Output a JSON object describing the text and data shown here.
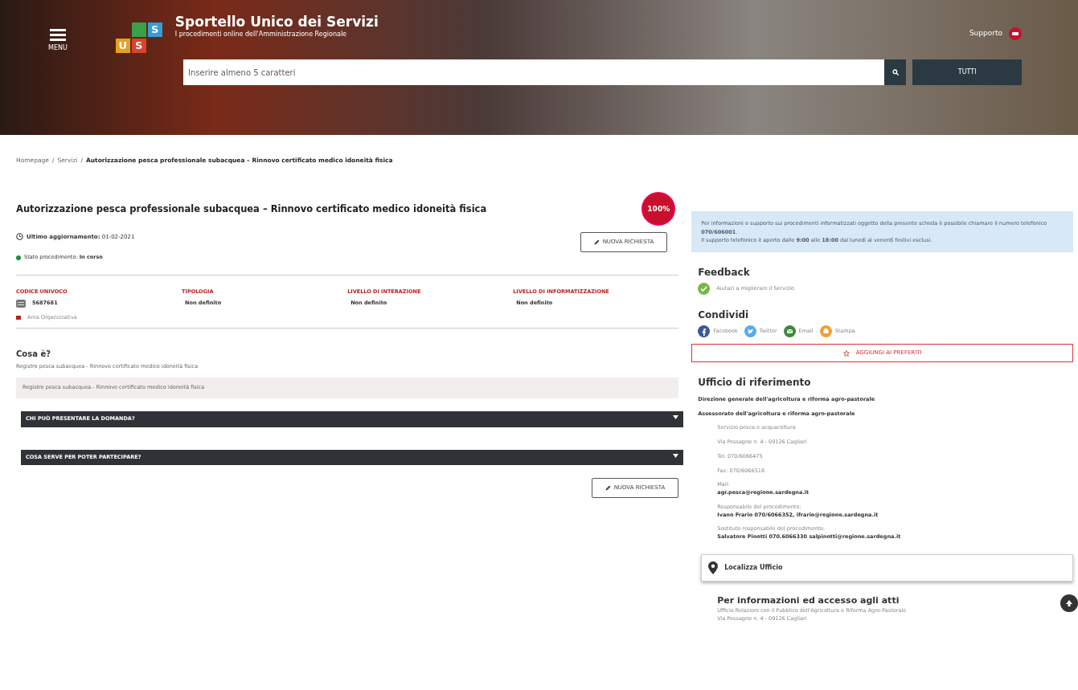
{
  "header": {
    "menu_label": "MENU",
    "logo_letters": [
      "S",
      "U",
      "S"
    ],
    "title": "Sportello Unico dei Servizi",
    "subtitle": "I procedimenti online dell'Amministrazione Regionale",
    "support": "Supporto",
    "search": {
      "placeholder": "Inserire almeno 5 caratteri"
    },
    "filter_button": "TUTTI"
  },
  "breadcrumb_separator": "/",
  "breadcrumb": [
    {
      "label": "Homepage",
      "current": false
    },
    {
      "label": "Servizi",
      "current": false
    },
    {
      "label": "Autorizzazione pesca professionale subacquea – Rinnovo certificato medico idoneità fisica",
      "current": true
    }
  ],
  "service": {
    "title": "Autorizzazione pesca professionale subacquea – Rinnovo certificato medico idoneità fisica",
    "online_badge": "100%",
    "updated_label": "Ultimo aggiornamento:",
    "updated_value": "01-02-2021",
    "status_label": "Stato procedimento:",
    "status_value": "In corso",
    "new_request": "NUOVA RICHIESTA",
    "facts": [
      {
        "label": "CODICE UNIVOCO",
        "value": "5687681",
        "kind": "code"
      },
      {
        "label": "TIPOLOGIA",
        "value": "Non definito",
        "kind": "text"
      },
      {
        "label": "LIVELLO DI INTERAZIONE",
        "value": "Non definito",
        "kind": "text"
      },
      {
        "label": "LIVELLO DI INFORMATIZZAZIONE",
        "value": "Non definito",
        "kind": "text"
      }
    ],
    "organizer": "Area Organizzativa"
  },
  "what": {
    "heading": "Cosa è?",
    "text": "Registro pesca subacquea - Rinnovo certificato medico idoneità fisica",
    "note": "Registro pesca subacquea - Rinnovo certificato medico idoneità fisica"
  },
  "accordions": [
    {
      "label": "CHI PUÒ PRESENTARE LA DOMANDA?",
      "expanded": false
    },
    {
      "label": "COSA SERVE PER POTER PARTECIPARE?",
      "expanded": false
    }
  ],
  "bottom_button": "NUOVA RICHIESTA",
  "info_box": [
    "Per informazioni e supporto sui procedimenti informatizzati oggetto della presente scheda è possibile chiamare il numero telefonico **070/606001**.",
    "Il supporto telefonico è aperto dalle **9:00** alle **18:00** dal lunedì al venerdì festivi esclusi."
  ],
  "feedback": {
    "heading": "Feedback",
    "link": "Aiutaci a migliorare il Servizio"
  },
  "share": {
    "heading": "Condividi",
    "items": [
      {
        "label": "Facebook",
        "kind": "facebook",
        "color": "#3b5998"
      },
      {
        "label": "Twitter",
        "kind": "twitter",
        "color": "#55acee"
      },
      {
        "label": "Email",
        "kind": "email",
        "color": "#3d8b37"
      },
      {
        "label": "Stampa",
        "kind": "print",
        "color": "#f0a030"
      }
    ]
  },
  "favorite_button": "AGGIUNGI AI PREFERITI",
  "office": {
    "heading": "Ufficio di riferimento",
    "direction": "Direzione generale dell'agricoltura e riforma agro-pastorale",
    "department": "Assessorato dell'agricoltura e riforma agro-pastorale",
    "lines": [
      "Servizio pesca e acquacoltura",
      "Via Pessagno n. 4 - 09126 Cagliari",
      "Tel. 070/6066475",
      "Fax: 070/6066518"
    ],
    "contacts": [
      {
        "label": "Mail:",
        "value": "agr.pesca@regione.sardegna.it"
      },
      {
        "label": "Responsabile del procedimento:",
        "value": "Ivano Frario 070/6066352, ifrario@regione.sardegna.it"
      },
      {
        "label": "Sostituto responsabile del procedimento:",
        "value": "Salvatore Pinotti 070.6066330 salpinotti@regione.sardegna.it"
      }
    ],
    "locate": "Localizza Ufficio"
  },
  "access": {
    "heading": "Per informazioni ed accesso agli atti",
    "lines": [
      "Ufficio Relazioni con il Pubblico dell'Agricoltura e Riforma Agro-Pastorale",
      "Via Pessagno n. 4 - 09126 Cagliari"
    ]
  }
}
